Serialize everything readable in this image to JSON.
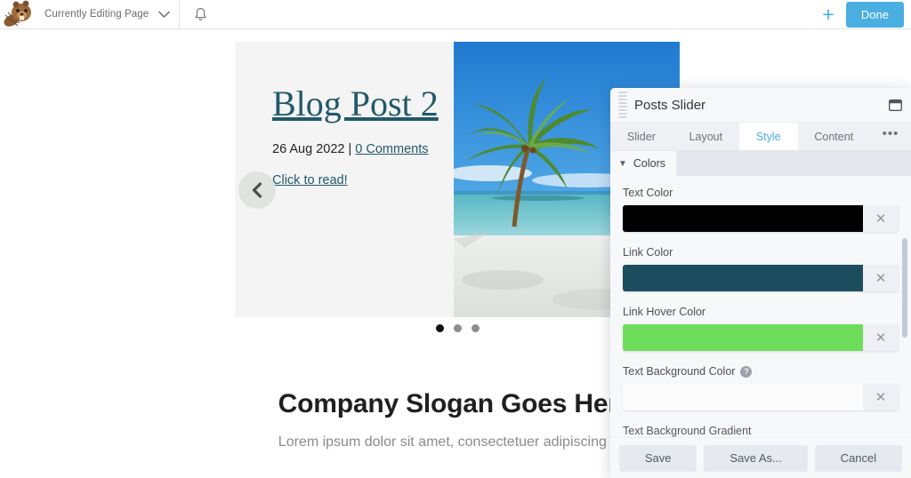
{
  "admin_bar": {
    "logo_icon": "beaver-logo-icon",
    "editing_label": "Currently Editing Page",
    "chevron_icon": "chevron-down-icon",
    "bell_icon": "bell-icon",
    "plus_icon": "plus-icon",
    "plus_label": "+",
    "done_label": "Done",
    "done_color": "#4aaee0"
  },
  "canvas": {
    "slider": {
      "post_title": "Blog Post 2",
      "post_date": "26 Aug 2022",
      "meta_separator": " | ",
      "comments_label": "0 Comments",
      "read_more_label": "Click to read!",
      "prev_icon": "chevron-left-icon",
      "photo_alt": "beach-palm-tree-photo",
      "dots": [
        {
          "active": true
        },
        {
          "active": false
        },
        {
          "active": false
        }
      ],
      "link_color": "#20596b",
      "background": "#f4f4f4"
    },
    "slogan": {
      "heading": "Company Slogan Goes Here",
      "subtext": "Lorem ipsum dolor sit amet, consectetuer adipiscing elit."
    }
  },
  "panel": {
    "grip_icon": "drag-handle-icon",
    "title": "Posts Slider",
    "dock_icon": "dock-window-icon",
    "tabs": [
      {
        "label": "Slider",
        "active": false
      },
      {
        "label": "Layout",
        "active": false
      },
      {
        "label": "Style",
        "active": true
      },
      {
        "label": "Content",
        "active": false
      }
    ],
    "more_label": "•••",
    "section": {
      "chevron_icon": "chevron-down-icon",
      "label": "Colors"
    },
    "fields": [
      {
        "label": "Text Color",
        "value": "#000000",
        "empty": false,
        "has_help": false,
        "clear_icon": "close-icon",
        "clear_label": "✕"
      },
      {
        "label": "Link Color",
        "value": "#1d4e5f",
        "empty": false,
        "has_help": false,
        "clear_icon": "close-icon",
        "clear_label": "✕"
      },
      {
        "label": "Link Hover Color",
        "value": "#6edd5c",
        "empty": false,
        "has_help": false,
        "clear_icon": "close-icon",
        "clear_label": "✕"
      },
      {
        "label": "Text Background Color",
        "value": "",
        "empty": true,
        "has_help": true,
        "help_label": "?",
        "clear_icon": "close-icon",
        "clear_label": "✕"
      }
    ],
    "cut_off_label": "Text Background Gradient",
    "footer": {
      "save_label": "Save",
      "save_as_label": "Save As...",
      "cancel_label": "Cancel"
    }
  }
}
